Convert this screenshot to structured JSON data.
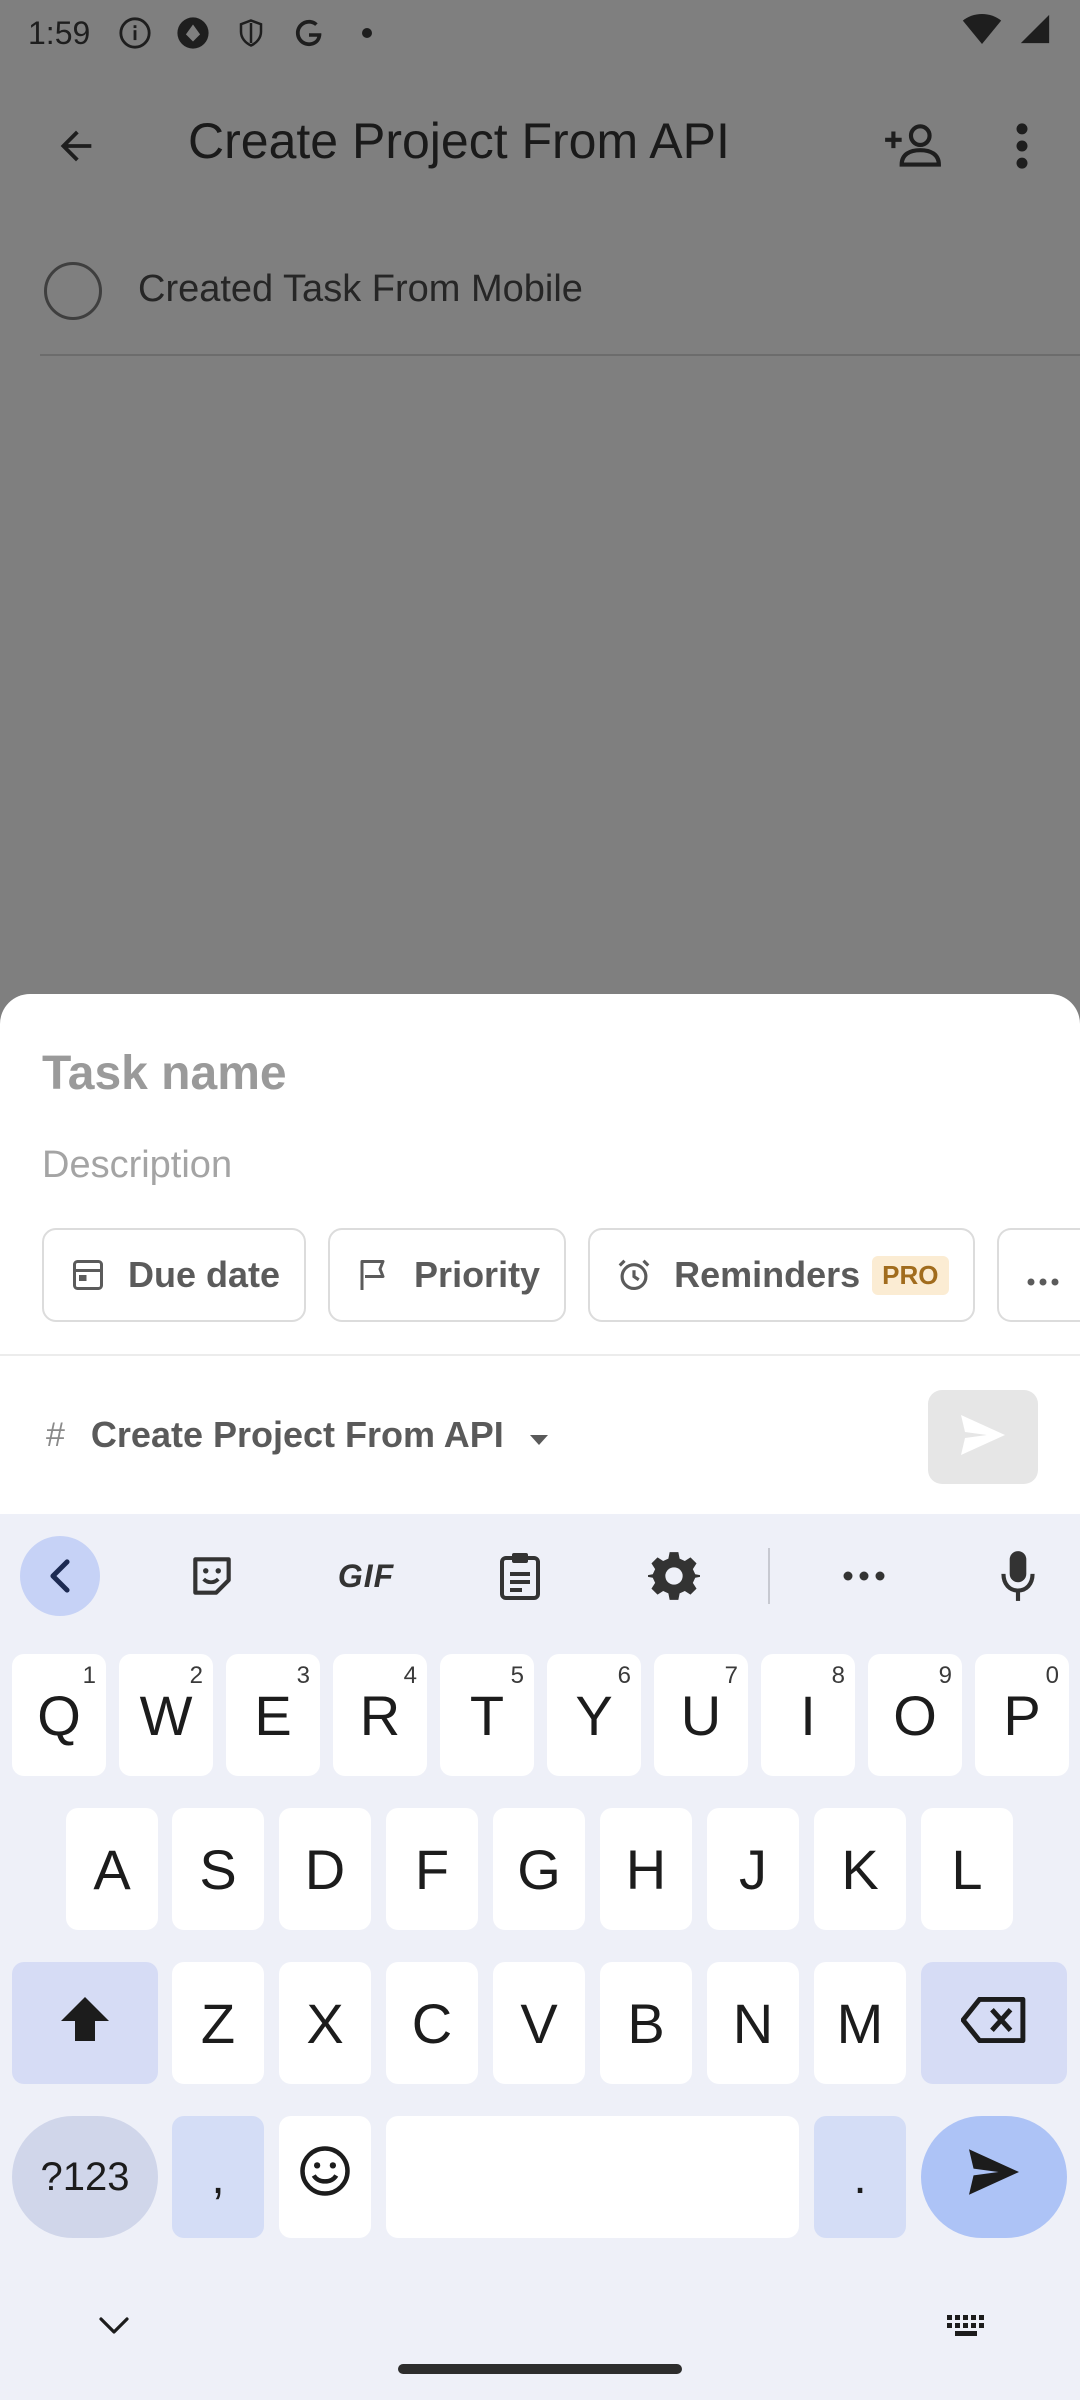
{
  "status_bar": {
    "time": "1:59"
  },
  "header": {
    "title": "Create Project From API"
  },
  "tasks": [
    {
      "title": "Created Task From Mobile"
    }
  ],
  "sheet": {
    "task_name_placeholder": "Task name",
    "description_placeholder": "Description",
    "chips": {
      "due_date": "Due date",
      "priority": "Priority",
      "reminders": "Reminders",
      "pro_badge": "PRO"
    },
    "project": "Create Project From API"
  },
  "keyboard": {
    "toolbar": {
      "gif": "GIF"
    },
    "row1": [
      {
        "k": "Q",
        "h": "1"
      },
      {
        "k": "W",
        "h": "2"
      },
      {
        "k": "E",
        "h": "3"
      },
      {
        "k": "R",
        "h": "4"
      },
      {
        "k": "T",
        "h": "5"
      },
      {
        "k": "Y",
        "h": "6"
      },
      {
        "k": "U",
        "h": "7"
      },
      {
        "k": "I",
        "h": "8"
      },
      {
        "k": "O",
        "h": "9"
      },
      {
        "k": "P",
        "h": "0"
      }
    ],
    "row2": [
      "A",
      "S",
      "D",
      "F",
      "G",
      "H",
      "J",
      "K",
      "L"
    ],
    "row3": [
      "Z",
      "X",
      "C",
      "V",
      "B",
      "N",
      "M"
    ],
    "sym_label": "?123",
    "comma": ",",
    "period": "."
  },
  "colors": {
    "dim_overlay": "#7f7f7f",
    "keyboard_bg": "#eef0f8",
    "accent_key": "#adc3f6",
    "pro_bg": "#fbecd3",
    "pro_text": "#a16c1d"
  }
}
